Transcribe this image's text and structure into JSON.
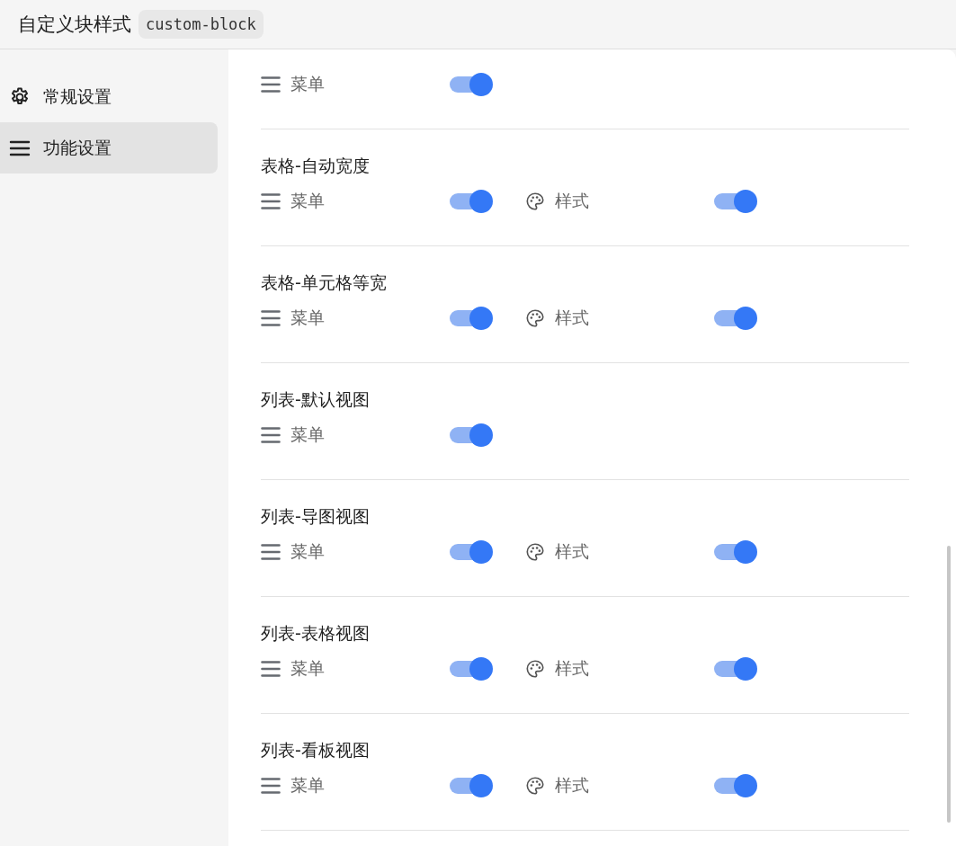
{
  "header": {
    "title": "自定义块样式",
    "code": "custom-block"
  },
  "sidebar": {
    "items": [
      {
        "kind": "gear",
        "label": "常规设置",
        "selected": false
      },
      {
        "kind": "menu",
        "label": "功能设置",
        "selected": true
      }
    ]
  },
  "sections": [
    {
      "toggles": [
        {
          "kind": "menu",
          "label": "菜单",
          "on": true
        }
      ]
    },
    {
      "title": "表格-自动宽度",
      "toggles": [
        {
          "kind": "menu",
          "label": "菜单",
          "on": true
        },
        {
          "kind": "style",
          "label": "样式",
          "on": true
        }
      ]
    },
    {
      "title": "表格-单元格等宽",
      "toggles": [
        {
          "kind": "menu",
          "label": "菜单",
          "on": true
        },
        {
          "kind": "style",
          "label": "样式",
          "on": true
        }
      ]
    },
    {
      "title": "列表-默认视图",
      "toggles": [
        {
          "kind": "menu",
          "label": "菜单",
          "on": true
        }
      ]
    },
    {
      "title": "列表-导图视图",
      "toggles": [
        {
          "kind": "menu",
          "label": "菜单",
          "on": true
        },
        {
          "kind": "style",
          "label": "样式",
          "on": true
        }
      ]
    },
    {
      "title": "列表-表格视图",
      "toggles": [
        {
          "kind": "menu",
          "label": "菜单",
          "on": true
        },
        {
          "kind": "style",
          "label": "样式",
          "on": true
        }
      ]
    },
    {
      "title": "列表-看板视图",
      "toggles": [
        {
          "kind": "menu",
          "label": "菜单",
          "on": true
        },
        {
          "kind": "style",
          "label": "样式",
          "on": true
        }
      ]
    }
  ]
}
